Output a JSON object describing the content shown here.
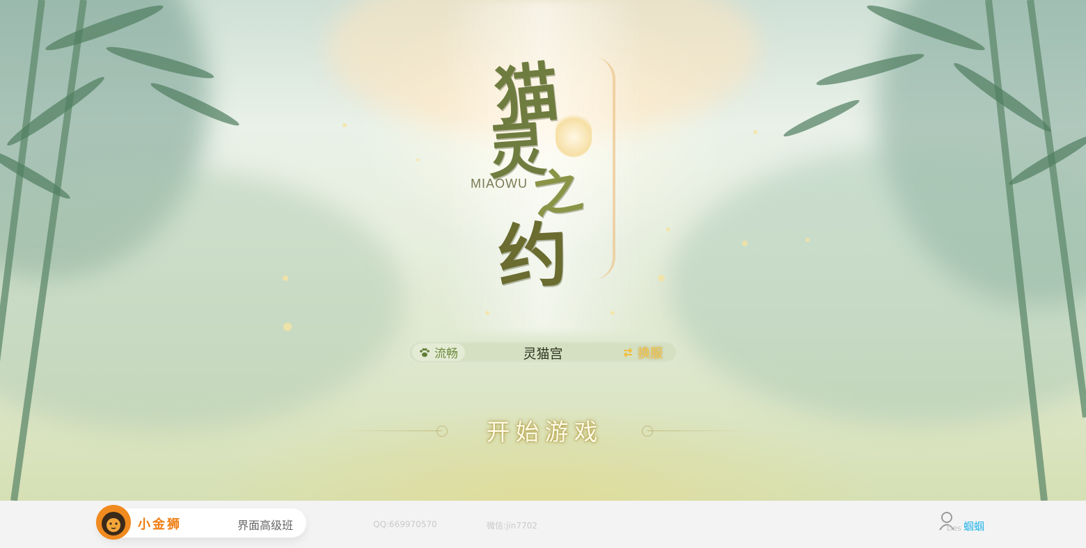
{
  "logo": {
    "chars": [
      "猫",
      "灵",
      "之",
      "约"
    ],
    "latin": "MIAOWU"
  },
  "server": {
    "status_label": "流畅",
    "name": "灵猫宫",
    "switch_label": "换服"
  },
  "start": {
    "label": "开始游戏"
  },
  "footer": {
    "brand": "小金狮",
    "course": "界面高级班",
    "qq": "QQ:669970570",
    "wechat": "微信:jin7702",
    "des": "Des",
    "author": "蝈蝈"
  }
}
